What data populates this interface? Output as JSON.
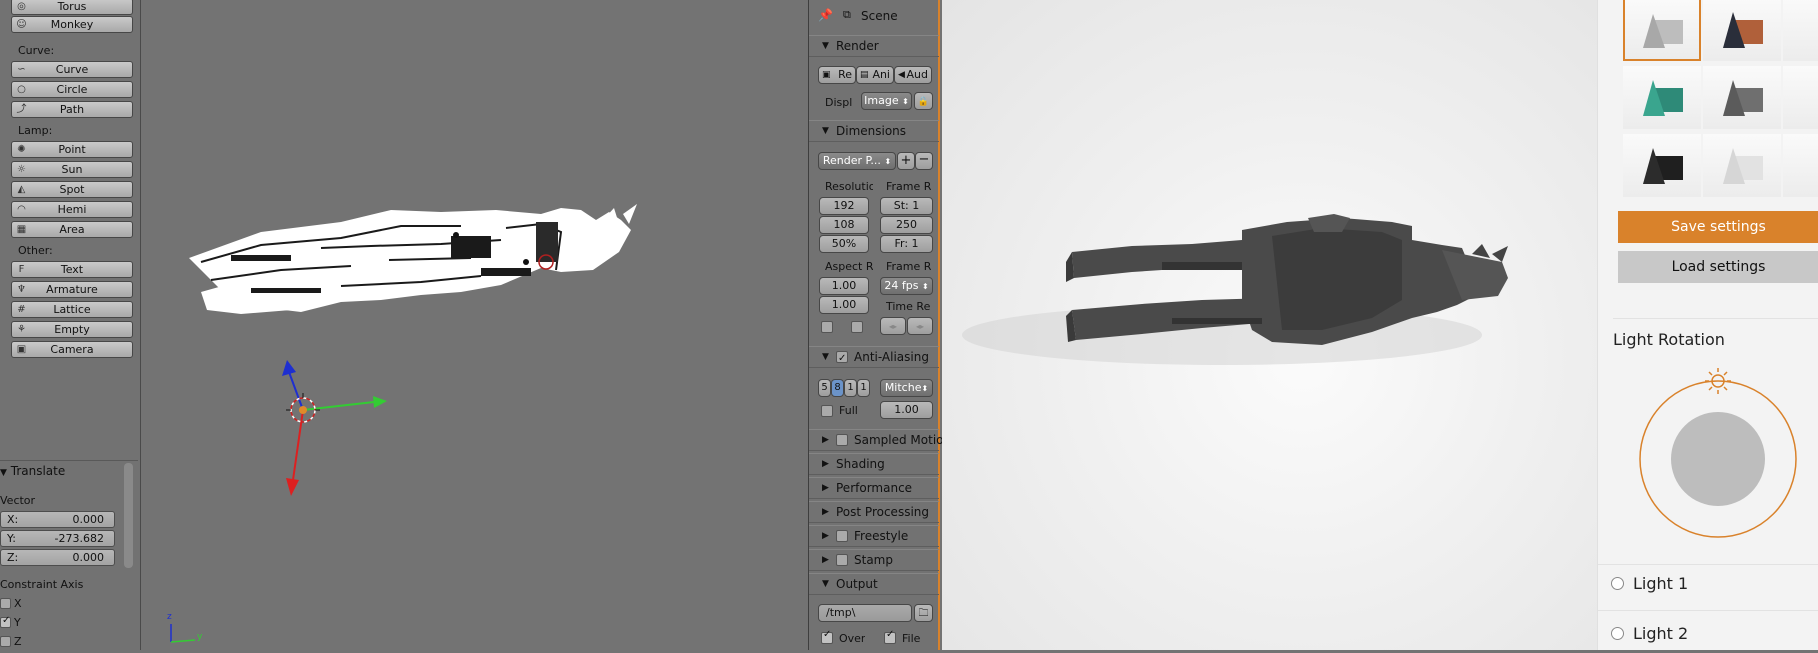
{
  "shelf": {
    "mesh_items": [
      {
        "label": "Torus",
        "icon": "torus-icon"
      },
      {
        "label": "Monkey",
        "icon": "monkey-icon"
      }
    ],
    "curve_header": "Curve:",
    "curve_items": [
      {
        "label": "Curve",
        "icon": "bezier-curve-icon"
      },
      {
        "label": "Circle",
        "icon": "curve-circle-icon"
      },
      {
        "label": "Path",
        "icon": "curve-path-icon"
      }
    ],
    "lamp_header": "Lamp:",
    "lamp_items": [
      {
        "label": "Point",
        "icon": "point-lamp-icon"
      },
      {
        "label": "Sun",
        "icon": "sun-lamp-icon"
      },
      {
        "label": "Spot",
        "icon": "spot-lamp-icon"
      },
      {
        "label": "Hemi",
        "icon": "hemi-lamp-icon"
      },
      {
        "label": "Area",
        "icon": "area-lamp-icon"
      }
    ],
    "other_header": "Other:",
    "other_items": [
      {
        "label": "Text",
        "icon": "text-icon"
      },
      {
        "label": "Armature",
        "icon": "armature-icon"
      },
      {
        "label": "Lattice",
        "icon": "lattice-icon"
      },
      {
        "label": "Empty",
        "icon": "empty-icon"
      },
      {
        "label": "Camera",
        "icon": "camera-icon"
      }
    ]
  },
  "operator": {
    "title": "Translate",
    "vector_label": "Vector",
    "x": {
      "k": "X:",
      "v": "0.000"
    },
    "y": {
      "k": "Y:",
      "v": "-273.682"
    },
    "z": {
      "k": "Z:",
      "v": "0.000"
    },
    "constraint_label": "Constraint Axis",
    "axes": [
      {
        "label": "X",
        "checked": false
      },
      {
        "label": "Y",
        "checked": true
      },
      {
        "label": "Z",
        "checked": false
      }
    ]
  },
  "viewport": {
    "axis_z": "z",
    "axis_y": "y"
  },
  "props": {
    "scene_label": "Scene",
    "render_header": "Render",
    "render_buttons": [
      "Re",
      "Ani",
      "Aud"
    ],
    "display_label": "Displ",
    "display_value": "Image",
    "dimensions_header": "Dimensions",
    "preset_value": "Render P...",
    "resolution_label": "Resolutio",
    "frame_range_label": "Frame R",
    "res_x": "192",
    "res_y": "108",
    "res_pct": "50%",
    "frame_start": "St: 1",
    "frame_end": "250",
    "frame_step": "Fr: 1",
    "aspect_label": "Aspect R",
    "frame_rate_label": "Frame R",
    "aspect_x": "1.00",
    "aspect_y": "1.00",
    "fps": "24 fps",
    "time_remap_label": "Time Re",
    "aa_header": "Anti-Aliasing",
    "aa_samples": [
      "5",
      "8",
      "1",
      "1"
    ],
    "aa_filter": "Mitche",
    "full_label": "Full",
    "full_value": "1.00",
    "sampled_motion_header": "Sampled Motio",
    "shading_header": "Shading",
    "performance_header": "Performance",
    "post_processing_header": "Post Processing",
    "freestyle_header": "Freestyle",
    "stamp_header": "Stamp",
    "output_header": "Output",
    "output_path": "/tmp\\",
    "overwrite_label": "Over",
    "file_ext_label": "File"
  },
  "right": {
    "save_label": "Save settings",
    "load_label": "Load settings",
    "light_rotation_label": "Light Rotation",
    "light1_label": "Light 1",
    "light2_label": "Light 2",
    "accent": "#d9822b",
    "button_gray": "#c8c8c8"
  }
}
